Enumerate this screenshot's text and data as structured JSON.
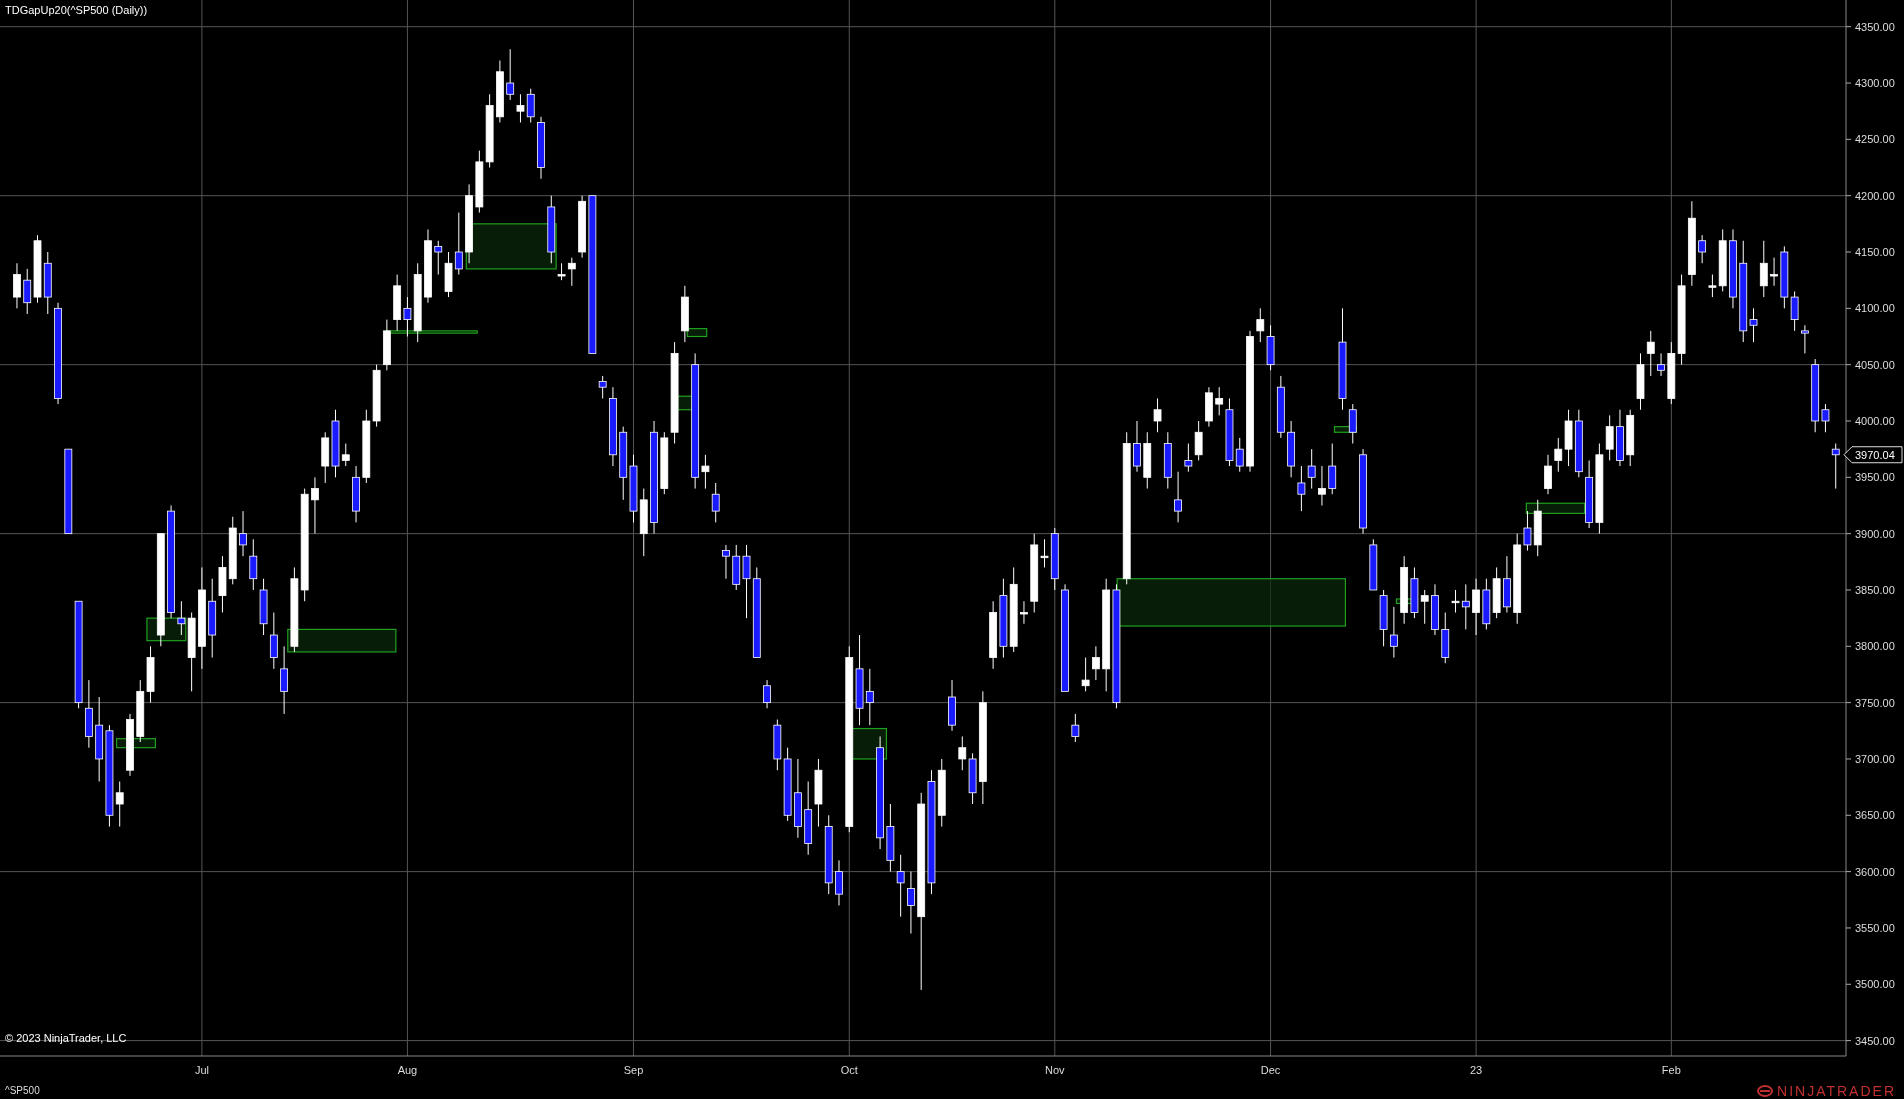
{
  "title": "TDGapUp20(^SP500 (Daily))",
  "copyright": "© 2023 NinjaTrader, LLC",
  "chart_data": {
    "type": "candlestick",
    "grid": true,
    "ylim": [
      3450,
      4350
    ],
    "categories": [
      null,
      null,
      null,
      null,
      null,
      null,
      null,
      null,
      null,
      null,
      null,
      null,
      null,
      null,
      null,
      null,
      null,
      null,
      "Jul",
      null,
      null,
      null,
      null,
      null,
      null,
      null,
      null,
      null,
      null,
      null,
      null,
      null,
      null,
      null,
      null,
      null,
      null,
      null,
      "Aug",
      null,
      null,
      null,
      null,
      null,
      null,
      null,
      null,
      null,
      null,
      null,
      null,
      null,
      null,
      null,
      null,
      null,
      null,
      null,
      null,
      null,
      "Sep",
      null,
      null,
      null,
      null,
      null,
      null,
      null,
      null,
      null,
      null,
      null,
      null,
      null,
      null,
      null,
      null,
      null,
      null,
      null,
      null,
      "Oct",
      null,
      null,
      null,
      null,
      null,
      null,
      null,
      null,
      null,
      null,
      null,
      null,
      null,
      null,
      null,
      null,
      null,
      null,
      null,
      "Nov",
      null,
      null,
      null,
      null,
      null,
      null,
      null,
      null,
      null,
      null,
      null,
      null,
      null,
      null,
      null,
      null,
      null,
      null,
      null,
      null,
      "Dec",
      null,
      null,
      null,
      null,
      null,
      null,
      null,
      null,
      null,
      null,
      null,
      null,
      null,
      null,
      null,
      null,
      null,
      null,
      null,
      "23",
      null,
      null,
      null,
      null,
      null,
      null,
      null,
      null,
      null,
      null,
      null,
      null,
      null,
      null,
      null,
      null,
      null,
      null,
      "Feb",
      null,
      null,
      null,
      null,
      null,
      null,
      null,
      null,
      null,
      null,
      null,
      null,
      null,
      null,
      null,
      null
    ],
    "yticks": [
      {
        "value": 4350,
        "label": "4350.00"
      },
      {
        "value": 4300,
        "label": "4300.00"
      },
      {
        "value": 4250,
        "label": "4250.00"
      },
      {
        "value": 4200,
        "label": "4200.00"
      },
      {
        "value": 4150,
        "label": "4150.00"
      },
      {
        "value": 4100,
        "label": "4100.00"
      },
      {
        "value": 4050,
        "label": "4050.00"
      },
      {
        "value": 4000,
        "label": "4000.00"
      },
      {
        "value": 3950,
        "label": "3950.00"
      },
      {
        "value": 3900,
        "label": "3900.00"
      },
      {
        "value": 3850,
        "label": "3850.00"
      },
      {
        "value": 3800,
        "label": "3800.00"
      },
      {
        "value": 3750,
        "label": "3750.00"
      },
      {
        "value": 3700,
        "label": "3700.00"
      },
      {
        "value": 3650,
        "label": "3650.00"
      },
      {
        "value": 3600,
        "label": "3600.00"
      },
      {
        "value": 3550,
        "label": "3550.00"
      },
      {
        "value": 3500,
        "label": "3500.00"
      },
      {
        "value": 3450,
        "label": "3450.00"
      }
    ],
    "ohlc": [
      [
        4110,
        4140,
        4100,
        4130
      ],
      [
        4125,
        4135,
        4095,
        4105
      ],
      [
        4110,
        4165,
        4105,
        4160
      ],
      [
        4140,
        4150,
        4095,
        4110
      ],
      [
        4100,
        4105,
        4015,
        4020
      ],
      [
        3975,
        3975,
        3900,
        3900
      ],
      [
        3840,
        3840,
        3745,
        3750
      ],
      [
        3745,
        3770,
        3710,
        3720
      ],
      [
        3730,
        3755,
        3680,
        3700
      ],
      [
        3725,
        3730,
        3640,
        3650
      ],
      [
        3660,
        3680,
        3640,
        3670
      ],
      [
        3690,
        3740,
        3685,
        3735
      ],
      [
        3720,
        3770,
        3715,
        3760
      ],
      [
        3760,
        3800,
        3750,
        3790
      ],
      [
        3810,
        3900,
        3800,
        3900
      ],
      [
        3920,
        3925,
        3825,
        3830
      ],
      [
        3825,
        3840,
        3810,
        3820
      ],
      [
        3790,
        3830,
        3760,
        3825
      ],
      [
        3800,
        3870,
        3780,
        3850
      ],
      [
        3840,
        3860,
        3790,
        3810
      ],
      [
        3845,
        3880,
        3830,
        3870
      ],
      [
        3860,
        3915,
        3855,
        3905
      ],
      [
        3900,
        3920,
        3880,
        3890
      ],
      [
        3880,
        3895,
        3850,
        3860
      ],
      [
        3850,
        3860,
        3810,
        3820
      ],
      [
        3810,
        3830,
        3780,
        3790
      ],
      [
        3780,
        3800,
        3740,
        3760
      ],
      [
        3800,
        3870,
        3795,
        3860
      ],
      [
        3850,
        3940,
        3840,
        3935
      ],
      [
        3930,
        3950,
        3900,
        3940
      ],
      [
        3960,
        3990,
        3945,
        3985
      ],
      [
        4000,
        4010,
        3950,
        3960
      ],
      [
        3965,
        3980,
        3960,
        3970
      ],
      [
        3950,
        3960,
        3910,
        3920
      ],
      [
        3950,
        4010,
        3945,
        4000
      ],
      [
        4000,
        4050,
        3995,
        4045
      ],
      [
        4050,
        4090,
        4045,
        4080
      ],
      [
        4090,
        4130,
        4080,
        4120
      ],
      [
        4100,
        4110,
        4075,
        4090
      ],
      [
        4080,
        4140,
        4070,
        4130
      ],
      [
        4110,
        4170,
        4105,
        4160
      ],
      [
        4155,
        4160,
        4130,
        4150
      ],
      [
        4115,
        4150,
        4110,
        4140
      ],
      [
        4150,
        4185,
        4130,
        4135
      ],
      [
        4150,
        4210,
        4140,
        4200
      ],
      [
        4190,
        4240,
        4185,
        4230
      ],
      [
        4230,
        4290,
        4225,
        4280
      ],
      [
        4270,
        4320,
        4265,
        4310
      ],
      [
        4300,
        4330,
        4285,
        4290
      ],
      [
        4275,
        4290,
        4265,
        4280
      ],
      [
        4290,
        4295,
        4265,
        4270
      ],
      [
        4265,
        4270,
        4215,
        4225
      ],
      [
        4190,
        4200,
        4140,
        4150
      ],
      [
        4130,
        4140,
        4125,
        4130
      ],
      [
        4135,
        4145,
        4120,
        4140
      ],
      [
        4150,
        4200,
        4145,
        4195
      ],
      [
        4200,
        4200,
        4060,
        4060
      ],
      [
        4035,
        4040,
        4020,
        4030
      ],
      [
        4020,
        4030,
        3960,
        3970
      ],
      [
        3990,
        3995,
        3930,
        3950
      ],
      [
        3960,
        3970,
        3910,
        3920
      ],
      [
        3900,
        3940,
        3880,
        3930
      ],
      [
        3990,
        4000,
        3900,
        3910
      ],
      [
        3940,
        3990,
        3935,
        3985
      ],
      [
        3990,
        4070,
        3980,
        4060
      ],
      [
        4080,
        4120,
        4070,
        4110
      ],
      [
        4050,
        4060,
        3940,
        3950
      ],
      [
        3955,
        3970,
        3940,
        3960
      ],
      [
        3935,
        3945,
        3910,
        3920
      ],
      [
        3885,
        3890,
        3860,
        3880
      ],
      [
        3880,
        3890,
        3850,
        3855
      ],
      [
        3880,
        3890,
        3825,
        3860
      ],
      [
        3860,
        3870,
        3790,
        3790
      ],
      [
        3765,
        3770,
        3745,
        3750
      ],
      [
        3730,
        3735,
        3690,
        3700
      ],
      [
        3700,
        3710,
        3645,
        3650
      ],
      [
        3670,
        3700,
        3630,
        3640
      ],
      [
        3655,
        3680,
        3615,
        3625
      ],
      [
        3660,
        3700,
        3640,
        3690
      ],
      [
        3640,
        3650,
        3580,
        3590
      ],
      [
        3600,
        3610,
        3570,
        3580
      ],
      [
        3640,
        3800,
        3635,
        3790
      ],
      [
        3780,
        3810,
        3730,
        3745
      ],
      [
        3760,
        3780,
        3730,
        3750
      ],
      [
        3710,
        3720,
        3620,
        3630
      ],
      [
        3640,
        3660,
        3600,
        3610
      ],
      [
        3600,
        3615,
        3560,
        3590
      ],
      [
        3585,
        3600,
        3545,
        3570
      ],
      [
        3560,
        3670,
        3495,
        3660
      ],
      [
        3680,
        3690,
        3580,
        3590
      ],
      [
        3650,
        3700,
        3640,
        3690
      ],
      [
        3755,
        3770,
        3725,
        3730
      ],
      [
        3700,
        3720,
        3690,
        3710
      ],
      [
        3700,
        3705,
        3660,
        3670
      ],
      [
        3680,
        3760,
        3660,
        3750
      ],
      [
        3790,
        3840,
        3780,
        3830
      ],
      [
        3845,
        3860,
        3790,
        3800
      ],
      [
        3800,
        3870,
        3795,
        3855
      ],
      [
        3830,
        3840,
        3820,
        3830
      ],
      [
        3840,
        3900,
        3830,
        3890
      ],
      [
        3880,
        3895,
        3870,
        3880
      ],
      [
        3900,
        3905,
        3850,
        3860
      ],
      [
        3850,
        3855,
        3760,
        3760
      ],
      [
        3730,
        3740,
        3715,
        3720
      ],
      [
        3765,
        3790,
        3760,
        3770
      ],
      [
        3780,
        3800,
        3770,
        3790
      ],
      [
        3780,
        3860,
        3760,
        3850
      ],
      [
        3850,
        3855,
        3745,
        3750
      ],
      [
        3860,
        3990,
        3855,
        3980
      ],
      [
        3980,
        4000,
        3955,
        3960
      ],
      [
        3950,
        3990,
        3940,
        3980
      ],
      [
        4000,
        4020,
        3990,
        4010
      ],
      [
        3980,
        3990,
        3940,
        3950
      ],
      [
        3930,
        3955,
        3910,
        3920
      ],
      [
        3965,
        3980,
        3955,
        3960
      ],
      [
        3970,
        4000,
        3965,
        3990
      ],
      [
        4000,
        4030,
        3995,
        4025
      ],
      [
        4015,
        4030,
        4005,
        4020
      ],
      [
        4010,
        4020,
        3960,
        3965
      ],
      [
        3975,
        3985,
        3955,
        3960
      ],
      [
        3960,
        4080,
        3955,
        4075
      ],
      [
        4080,
        4100,
        4070,
        4090
      ],
      [
        4075,
        4085,
        4045,
        4050
      ],
      [
        4030,
        4040,
        3985,
        3990
      ],
      [
        3990,
        4000,
        3950,
        3960
      ],
      [
        3945,
        3960,
        3920,
        3935
      ],
      [
        3960,
        3975,
        3940,
        3950
      ],
      [
        3935,
        3960,
        3925,
        3940
      ],
      [
        3960,
        3980,
        3935,
        3940
      ],
      [
        4070,
        4100,
        4010,
        4020
      ],
      [
        4010,
        4015,
        3980,
        3990
      ],
      [
        3970,
        3975,
        3900,
        3905
      ],
      [
        3890,
        3895,
        3850,
        3850
      ],
      [
        3845,
        3850,
        3800,
        3815
      ],
      [
        3810,
        3835,
        3790,
        3800
      ],
      [
        3830,
        3880,
        3820,
        3870
      ],
      [
        3860,
        3870,
        3825,
        3830
      ],
      [
        3840,
        3850,
        3820,
        3845
      ],
      [
        3845,
        3855,
        3810,
        3815
      ],
      [
        3815,
        3830,
        3785,
        3790
      ],
      [
        3840,
        3850,
        3830,
        3840
      ],
      [
        3840,
        3855,
        3815,
        3835
      ],
      [
        3830,
        3860,
        3810,
        3850
      ],
      [
        3850,
        3860,
        3815,
        3820
      ],
      [
        3830,
        3870,
        3825,
        3860
      ],
      [
        3860,
        3880,
        3830,
        3835
      ],
      [
        3830,
        3900,
        3820,
        3890
      ],
      [
        3905,
        3920,
        3885,
        3890
      ],
      [
        3890,
        3930,
        3880,
        3920
      ],
      [
        3940,
        3970,
        3935,
        3960
      ],
      [
        3965,
        3985,
        3955,
        3975
      ],
      [
        3975,
        4010,
        3960,
        4000
      ],
      [
        4000,
        4010,
        3950,
        3955
      ],
      [
        3950,
        3965,
        3905,
        3910
      ],
      [
        3910,
        3980,
        3900,
        3970
      ],
      [
        3975,
        4005,
        3965,
        3995
      ],
      [
        3995,
        4010,
        3960,
        3965
      ],
      [
        3970,
        4010,
        3960,
        4005
      ],
      [
        4020,
        4060,
        4010,
        4050
      ],
      [
        4060,
        4080,
        4040,
        4070
      ],
      [
        4050,
        4060,
        4040,
        4045
      ],
      [
        4020,
        4070,
        4015,
        4060
      ],
      [
        4060,
        4130,
        4050,
        4120
      ],
      [
        4130,
        4195,
        4120,
        4180
      ],
      [
        4160,
        4165,
        4140,
        4150
      ],
      [
        4120,
        4130,
        4110,
        4120
      ],
      [
        4120,
        4170,
        4115,
        4160
      ],
      [
        4160,
        4170,
        4100,
        4110
      ],
      [
        4140,
        4160,
        4070,
        4080
      ],
      [
        4090,
        4100,
        4070,
        4085
      ],
      [
        4120,
        4160,
        4110,
        4140
      ],
      [
        4130,
        4145,
        4120,
        4130
      ],
      [
        4150,
        4155,
        4100,
        4110
      ],
      [
        4110,
        4115,
        4080,
        4090
      ],
      [
        4080,
        4085,
        4060,
        4078
      ],
      [
        4050,
        4055,
        3990,
        4000
      ],
      [
        4010,
        4015,
        3990,
        4000
      ],
      [
        3975,
        3980,
        3940,
        3970
      ]
    ]
  },
  "current_price": "3970.04",
  "status_bar": {
    "symbol": "^SP500",
    "logo": "NINJATRADER"
  }
}
